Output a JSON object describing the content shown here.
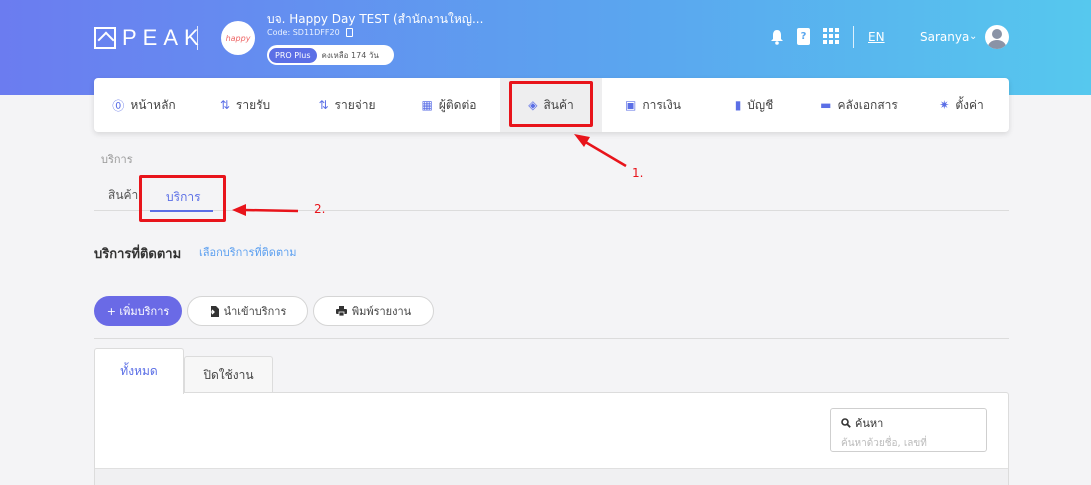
{
  "header": {
    "logo_text": "PEAK",
    "company_logo_text": "happy",
    "company_name": "บจ. Happy Day TEST (สำนักงานใหญ่...",
    "company_code": "Code: SD11DFF20",
    "plan_badge": "PRO Plus",
    "plan_remaining": "คงเหลือ 174 วัน",
    "book_icon_glyph": "?",
    "language": "EN",
    "user_name": "Saranya",
    "chevron": "⌄"
  },
  "nav": {
    "items": [
      {
        "label": "หน้าหลัก",
        "icon": "dashboard-icon",
        "glyph": "⓪"
      },
      {
        "label": "รายรับ",
        "icon": "income-icon",
        "glyph": "⇅"
      },
      {
        "label": "รายจ่าย",
        "icon": "expense-icon",
        "glyph": "⇅"
      },
      {
        "label": "ผู้ติดต่อ",
        "icon": "contacts-icon",
        "glyph": "▦"
      },
      {
        "label": "สินค้า",
        "icon": "product-box-icon",
        "glyph": "◈"
      },
      {
        "label": "การเงิน",
        "icon": "money-icon",
        "glyph": "▣"
      },
      {
        "label": "บัญชี",
        "icon": "ledger-icon",
        "glyph": "▮"
      },
      {
        "label": "คลังเอกสาร",
        "icon": "folder-icon",
        "glyph": "▬"
      },
      {
        "label": "ตั้งค่า",
        "icon": "gear-icon",
        "glyph": "✷"
      }
    ],
    "active_index": 4
  },
  "breadcrumb": "บริการ",
  "tabs": {
    "products": "สินค้า",
    "services": "บริการ"
  },
  "annotations": {
    "label1": "1.",
    "label2": "2."
  },
  "section": {
    "title": "บริการที่ติดตาม",
    "link": "เลือกบริการที่ติดตาม"
  },
  "buttons": {
    "add": "+ เพิ่มบริการ",
    "import": "นำเข้าบริการ",
    "print": "พิมพ์รายงาน"
  },
  "panel_tabs": {
    "all": "ทั้งหมด",
    "disabled": "ปิดใช้งาน"
  },
  "search": {
    "label": "ค้นหา",
    "placeholder": "ค้นหาด้วยชื่อ, เลขที่"
  },
  "colors": {
    "accent": "#5b6fe6",
    "highlight": "#e8141b",
    "link": "#5b9ff0"
  }
}
